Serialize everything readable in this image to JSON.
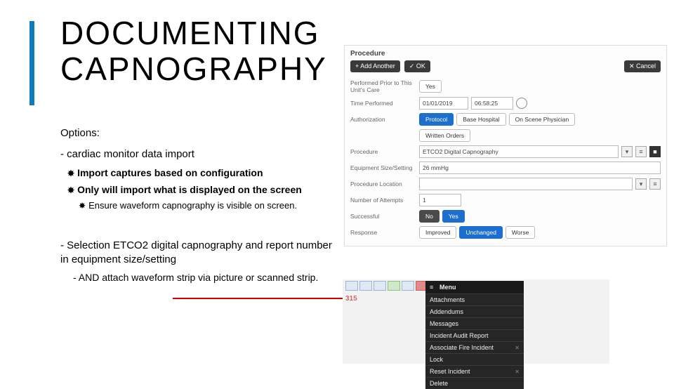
{
  "title_line1": "DOCUMENTING",
  "title_line2": "CAPNOGRAPHY",
  "options_label": "Options:",
  "item1": "cardiac monitor data import",
  "item1a": "Import captures based on configuration",
  "item1b": "Only will import what is displayed on the screen",
  "item1b_sub": "Ensure waveform capnography is visible on screen.",
  "item2": "Selection ETCO2 digital capnography and report number in equipment size/setting",
  "item2a": "AND attach waveform strip via picture or scanned strip.",
  "form": {
    "header": "Procedure",
    "add_btn": "+ Add Another",
    "ok_btn": "✓ OK",
    "cancel_btn": "✕ Cancel",
    "rows": {
      "performed_prior_lbl": "Performed Prior to This Unit's Care",
      "performed_prior_val": "Yes",
      "time_lbl": "Time Performed",
      "date_val": "01/01/2019",
      "time_val": "06:58:25",
      "auth_lbl": "Authorization",
      "auth_a": "Protocol",
      "auth_b": "Base Hospital",
      "auth_c": "On Scene Physician",
      "auth_d": "Written Orders",
      "proc_lbl": "Procedure",
      "proc_val": "ETCO2 Digital Capnography",
      "equip_lbl": "Equipment Size/Setting",
      "equip_val": "26 mmHg",
      "loc_lbl": "Procedure Location",
      "attempts_lbl": "Number of Attempts",
      "attempts_val": "1",
      "success_lbl": "Successful",
      "success_no": "No",
      "success_yes": "Yes",
      "response_lbl": "Response",
      "resp_a": "Improved",
      "resp_b": "Unchanged",
      "resp_c": "Worse"
    }
  },
  "menu": {
    "num": "315",
    "title": "Menu",
    "items": [
      "Attachments",
      "Addendums",
      "Messages",
      "Incident Audit Report",
      "Associate Fire Incident",
      "Lock",
      "Reset Incident",
      "Delete"
    ]
  }
}
